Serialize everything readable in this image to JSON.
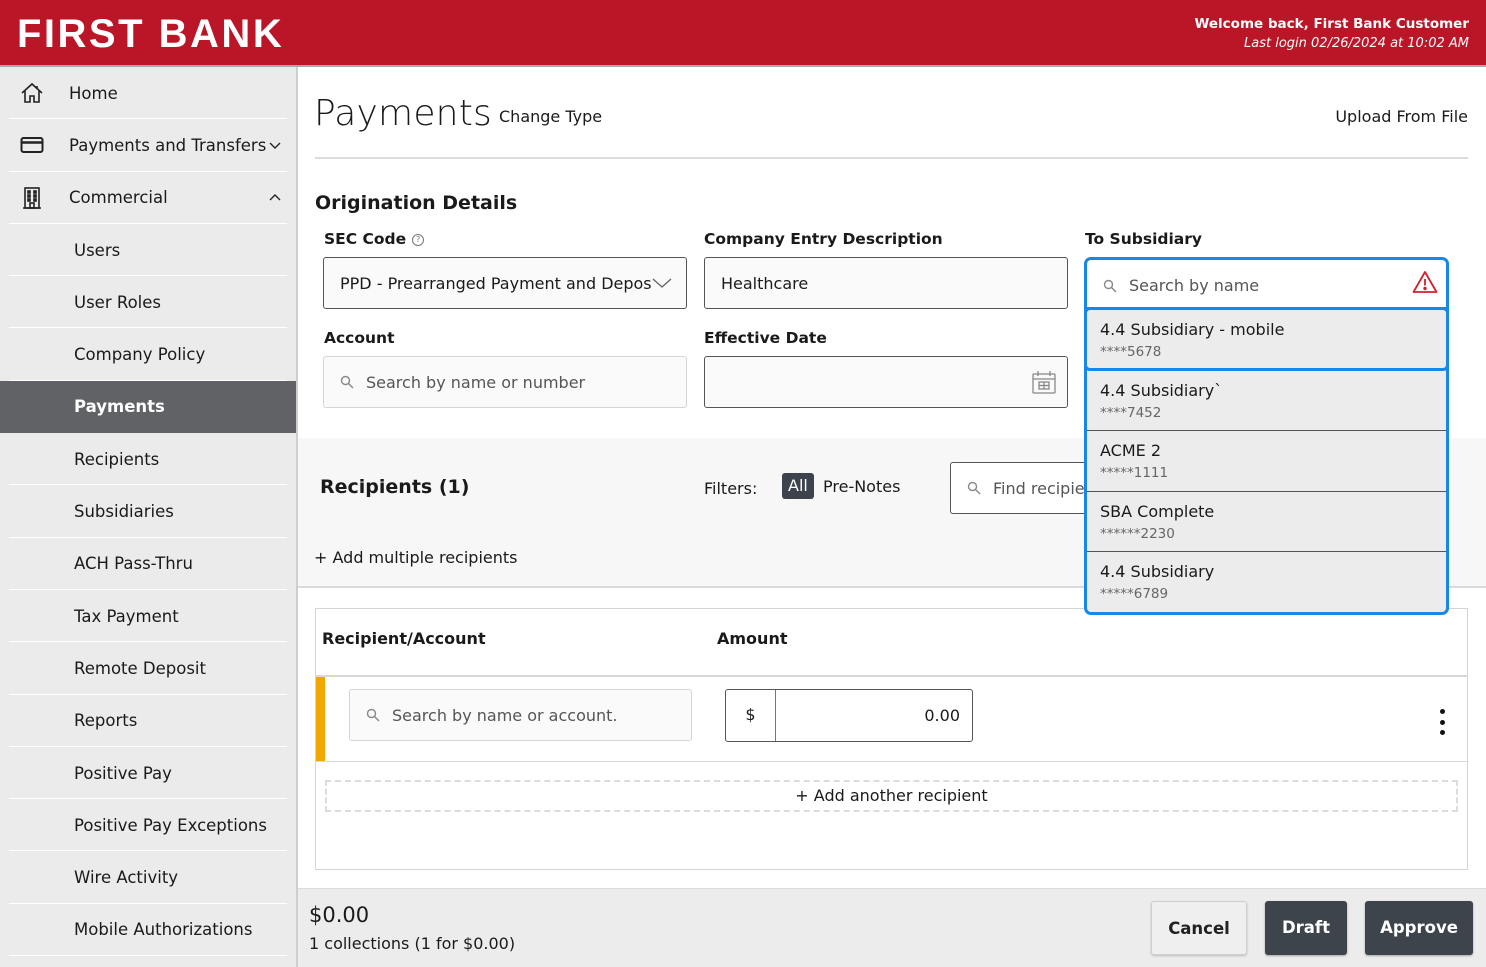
{
  "header": {
    "brand": "FIRST BANK",
    "welcome": "Welcome back, First Bank Customer",
    "last_login": "Last login 02/26/2024 at 10:02 AM",
    "brand_color": "#bb1628"
  },
  "sidebar": {
    "items": [
      {
        "label": "Home",
        "icon": "home-icon"
      },
      {
        "label": "Payments and Transfers",
        "icon": "credit-card-icon",
        "chevron": "chevron-down-icon"
      },
      {
        "label": "Commercial",
        "icon": "building-icon",
        "chevron": "chevron-up-icon"
      }
    ],
    "sub_items": [
      {
        "label": "Users"
      },
      {
        "label": "User Roles"
      },
      {
        "label": "Company Policy"
      },
      {
        "label": "Payments",
        "active": true
      },
      {
        "label": "Recipients"
      },
      {
        "label": "Subsidiaries"
      },
      {
        "label": "ACH Pass-Thru"
      },
      {
        "label": "Tax Payment"
      },
      {
        "label": "Remote Deposit"
      },
      {
        "label": "Reports"
      },
      {
        "label": "Positive Pay"
      },
      {
        "label": "Positive Pay Exceptions"
      },
      {
        "label": "Wire Activity"
      },
      {
        "label": "Mobile Authorizations"
      }
    ]
  },
  "page": {
    "title": "Payments",
    "change_type": "Change Type",
    "upload_from_file": "Upload From File"
  },
  "origination": {
    "section_title": "Origination Details",
    "sec_code": {
      "label": "SEC Code",
      "value": "PPD - Prearranged Payment and Deposi"
    },
    "company_entry": {
      "label": "Company Entry Description",
      "value": "Healthcare"
    },
    "to_subsidiary": {
      "label": "To Subsidiary",
      "placeholder": "Search by name"
    },
    "account": {
      "label": "Account",
      "placeholder": "Search by name or number"
    },
    "effective_date": {
      "label": "Effective Date",
      "value": ""
    }
  },
  "subsidiary_options": [
    {
      "name": "4.4 Subsidiary - mobile",
      "account": "****5678"
    },
    {
      "name": "4.4 Subsidiary`",
      "account": "****7452"
    },
    {
      "name": "ACME 2",
      "account": "*****1111"
    },
    {
      "name": "SBA Complete",
      "account": "******2230"
    },
    {
      "name": "4.4 Subsidiary",
      "account": "*****6789"
    }
  ],
  "recipients": {
    "title": "Recipients (1)",
    "filters_label": "Filters:",
    "filter_all": "All",
    "filter_prenotes": "Pre-Notes",
    "find_placeholder": "Find recipients",
    "add_multiple": "+ Add multiple recipients",
    "columns": [
      "Recipient/Account",
      "Amount"
    ],
    "rows": [
      {
        "recipient_placeholder": "Search by name or account.",
        "currency": "$",
        "amount": "0.00"
      }
    ],
    "add_another": "+ Add another recipient"
  },
  "footer": {
    "total": "$0.00",
    "summary": "1 collections (1 for $0.00)",
    "cancel": "Cancel",
    "draft": "Draft",
    "approve": "Approve"
  }
}
